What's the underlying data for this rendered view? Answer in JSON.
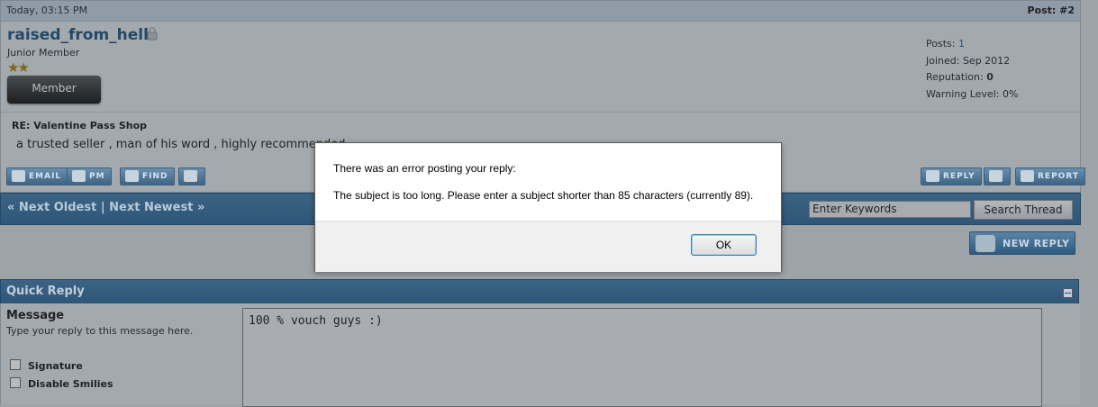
{
  "post": {
    "date": "Today, 03:15 PM",
    "number_label": "Post: #2",
    "username": "raised_from_hell",
    "user_title": "Junior Member",
    "stars": "★★",
    "badge": "Member",
    "stats": {
      "posts_label": "Posts:",
      "posts_value": "1",
      "joined": "Joined: Sep 2012",
      "reputation_label": "Reputation:",
      "reputation_value": "0",
      "warning": "Warning Level: 0%"
    },
    "title": "RE: Valentine Pass Shop",
    "text": "a trusted seller , man of his word , highly recommended",
    "buttons_left": [
      "EMAIL",
      "PM",
      "FIND"
    ],
    "buttons_right": [
      "REPLY",
      "REPORT"
    ]
  },
  "nav": {
    "next_oldest": "« Next Oldest",
    "separator": "|",
    "next_newest": "Next Newest »",
    "search_placeholder": "Enter Keywords",
    "search_button": "Search Thread"
  },
  "new_reply_label": "NEW REPLY",
  "quick_reply": {
    "title": "Quick Reply",
    "message_label": "Message",
    "message_desc": "Type your reply to this message here.",
    "signature": "Signature",
    "disable_smilies": "Disable Smilies",
    "message_value": "100 % vouch guys :)"
  },
  "dialog": {
    "line1": "There was an error posting your reply:",
    "line2": "The subject is too long. Please enter a subject shorter than 85 characters (currently 89).",
    "ok": "OK"
  }
}
